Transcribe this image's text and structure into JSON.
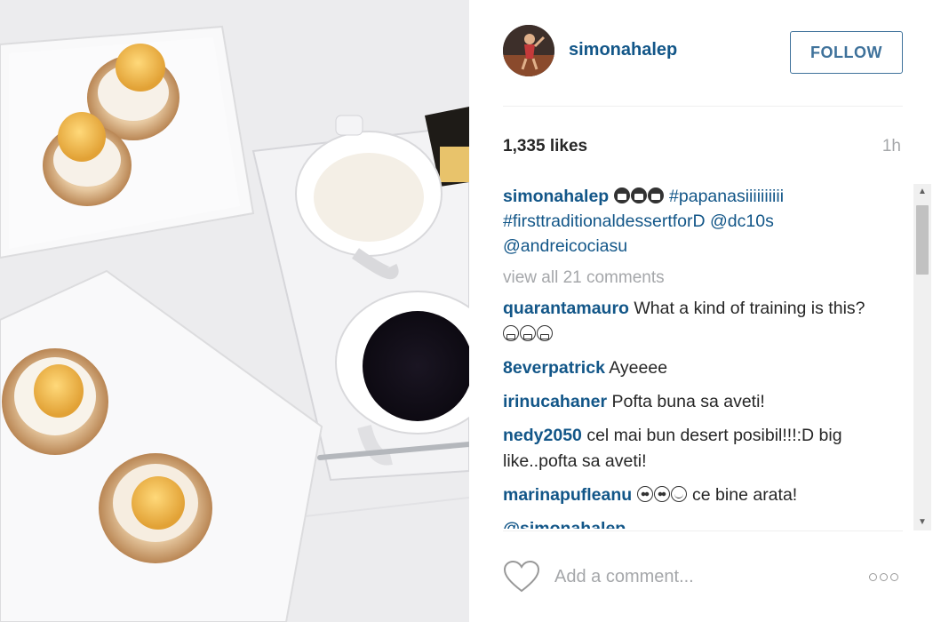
{
  "post": {
    "username": "simonahalep",
    "follow_label": "FOLLOW",
    "likes": "1,335 likes",
    "time_ago": "1h",
    "caption": {
      "user": "simonahalep",
      "emoji": "monkey-emoji",
      "hashtag1": "#papanasiiiiiiiiii",
      "hashtag2": "#firsttraditionaldessertforD",
      "mention1": "@dc10s",
      "mention2": "@andreicociasu"
    },
    "view_all": "view all 21 comments",
    "comments": [
      {
        "user": "quarantamauro",
        "text": "What a kind of training is this?",
        "emoji": "grinning-emoji"
      },
      {
        "user": "8everpatrick",
        "text": "Ayeeee"
      },
      {
        "user": "irinucahaner",
        "text": "Pofta buna sa aveti!"
      },
      {
        "user": "nedy2050",
        "text": "cel mai bun desert posibil!!!:D big like..pofta sa aveti!"
      },
      {
        "user": "marinapufleanu",
        "text": "ce bine arata!",
        "emoji": "heart-eyes-emoji"
      }
    ],
    "clipped_mention": "@simonahalep",
    "add_comment_placeholder": "Add a comment..."
  },
  "colors": {
    "link": "#125688",
    "follow_border": "#3f729b",
    "muted": "#a5a7aa"
  },
  "icons": [
    "heart-outline-icon",
    "more-options-icon",
    "scroll-up-icon",
    "scroll-down-icon"
  ]
}
